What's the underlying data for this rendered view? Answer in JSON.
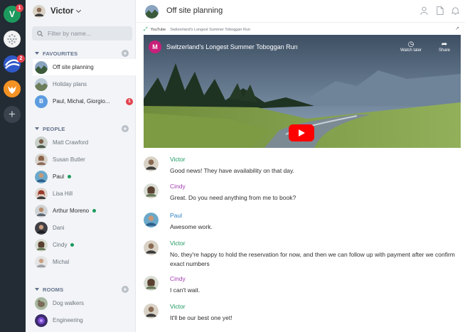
{
  "rail": {
    "spaces": [
      {
        "letter": "V",
        "badge": "1"
      },
      {
        "badge": ""
      },
      {
        "badge": "2"
      },
      {
        "badge": ""
      }
    ],
    "add_symbol": "+"
  },
  "user": {
    "name": "Victor"
  },
  "filter": {
    "placeholder": "Filter by name..."
  },
  "favourites": {
    "title": "FAVOURITES",
    "rooms": [
      {
        "name": "Off site planning"
      },
      {
        "name": "Holiday plans"
      },
      {
        "name": "Paul, Michal, Giorgio...",
        "letter": "B",
        "unread": "1"
      }
    ]
  },
  "people": {
    "title": "PEOPLE",
    "list": [
      {
        "name": "Matt Crawford"
      },
      {
        "name": "Susan Butler"
      },
      {
        "name": "Paul"
      },
      {
        "name": "Lisa Hill"
      },
      {
        "name": "Arthur Moreno"
      },
      {
        "name": "Dani"
      },
      {
        "name": "Cindy"
      },
      {
        "name": "Michal"
      }
    ]
  },
  "rooms": {
    "title": "ROOMS",
    "list": [
      {
        "name": "Dog walkers"
      },
      {
        "name": "Engineering"
      }
    ]
  },
  "header": {
    "title": "Off site planning"
  },
  "embed": {
    "source": "YouTube",
    "title": "Switzerland's Longest Summer Toboggan Run",
    "video_title": "Switzerland's Longest Summer Toboggan Run",
    "channel_letter": "M",
    "watch_later": "Watch later",
    "share": "Share"
  },
  "messages": [
    {
      "sender": "Victor",
      "text": "Good news! They have availability on that day."
    },
    {
      "sender": "Cindy",
      "text": "Great. Do you need anything from me to book?"
    },
    {
      "sender": "Paul",
      "text": "Awesome work."
    },
    {
      "sender": "Victor",
      "text": "No, they're happy to hold the reservation for now, and then we can follow up with payment after we confirm exact numbers"
    },
    {
      "sender": "Cindy",
      "text": "I can't wait."
    },
    {
      "sender": "Victor",
      "text": "It'll be our best one yet!"
    }
  ],
  "colors": {
    "rail": "#232b34",
    "panel": "#f2f4f7",
    "victor": "#1c9a5e",
    "cindy": "#a63cb3",
    "paul": "#2d7fc1",
    "badge": "#e2424e"
  }
}
